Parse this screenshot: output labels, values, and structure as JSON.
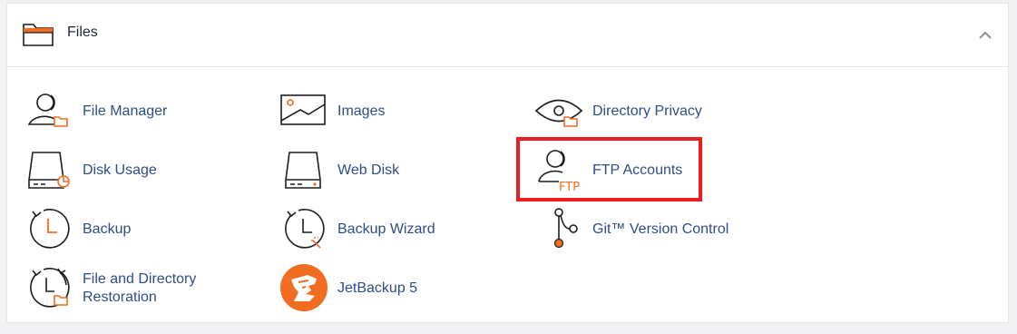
{
  "section": {
    "title": "Files",
    "icon": "folder-icon",
    "collapse_icon": "chevron-up-icon"
  },
  "items": [
    {
      "label": "File Manager",
      "icon": "file-manager-icon"
    },
    {
      "label": "Images",
      "icon": "image-icon"
    },
    {
      "label": "Directory Privacy",
      "icon": "eye-folder-icon"
    },
    {
      "label": "Disk Usage",
      "icon": "disk-usage-icon"
    },
    {
      "label": "Web Disk",
      "icon": "web-disk-icon"
    },
    {
      "label": "FTP Accounts",
      "icon": "ftp-user-icon"
    },
    {
      "label": "Backup",
      "icon": "backup-clock-icon"
    },
    {
      "label": "Backup Wizard",
      "icon": "backup-wizard-icon"
    },
    {
      "label": "Git™ Version Control",
      "icon": "git-branch-icon"
    },
    {
      "label": "File and Directory Restoration",
      "icon": "restore-folder-icon"
    },
    {
      "label": "JetBackup 5",
      "icon": "jetbackup-logo-icon"
    }
  ],
  "colors": {
    "accent": "#f26d21",
    "link": "#2d4d88",
    "highlight": "#ea1c24",
    "icon_stroke": "#1d1d1f"
  }
}
